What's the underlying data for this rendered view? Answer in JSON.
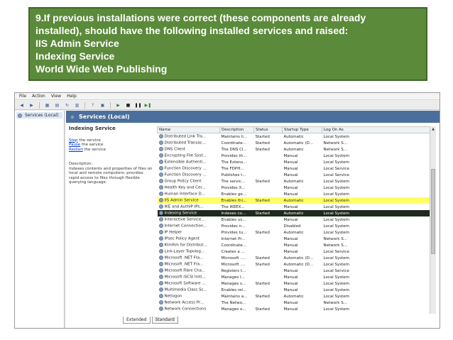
{
  "banner": {
    "lines": [
      "9.If previous installations were correct (these components are already",
      "installed), should have the following installed services and raised:",
      "IIS Admin Service",
      "Indexing Service",
      "World Wide Web Publishing"
    ],
    "background": "#5b8a3a"
  },
  "window": {
    "menu": [
      "File",
      "Action",
      "View",
      "Help"
    ],
    "tree_item": "Services (Local)",
    "main_title": "Services (Local)",
    "detail": {
      "service_name": "Indexing Service",
      "stop_link": "Stop",
      "stop_rest": " the service",
      "pause_link": "Pause",
      "pause_rest": " the service",
      "restart_link": "Restart",
      "restart_rest": " the service",
      "description_label": "Description:",
      "description_text": "Indexes contents and properties of files on local and remote computers; provides rapid access to files through flexible querying language."
    },
    "columns": [
      "Name",
      "Description",
      "Status",
      "Startup Type",
      "Log On As"
    ],
    "rows": [
      {
        "name": "Distributed Link Tra...",
        "desc": "Maintains li...",
        "status": "Started",
        "startup": "Automatic",
        "logon": "Local System",
        "state": ""
      },
      {
        "name": "Distributed Transac...",
        "desc": "Coordinate...",
        "status": "Started",
        "startup": "Automatic (D...",
        "logon": "Network S...",
        "state": ""
      },
      {
        "name": "DNS Client",
        "desc": "The DNS Cl...",
        "status": "Started",
        "startup": "Automatic",
        "logon": "Network S...",
        "state": ""
      },
      {
        "name": "Encrypting File Syst...",
        "desc": "Provides th...",
        "status": "",
        "startup": "Manual",
        "logon": "Local System",
        "state": ""
      },
      {
        "name": "Extensible Authenti...",
        "desc": "The Extens...",
        "status": "",
        "startup": "Manual",
        "logon": "Local System",
        "state": ""
      },
      {
        "name": "Function Discovery ...",
        "desc": "The FDPH...",
        "status": "",
        "startup": "Manual",
        "logon": "Local Service",
        "state": ""
      },
      {
        "name": "Function Discovery ...",
        "desc": "Publishes t...",
        "status": "",
        "startup": "Manual",
        "logon": "Local Service",
        "state": ""
      },
      {
        "name": "Group Policy Client",
        "desc": "The servic...",
        "status": "Started",
        "startup": "Automatic",
        "logon": "Local System",
        "state": ""
      },
      {
        "name": "Health Key and Cer...",
        "desc": "Provides X...",
        "status": "",
        "startup": "Manual",
        "logon": "Local System",
        "state": ""
      },
      {
        "name": "Human Interface D...",
        "desc": "Enables ge...",
        "status": "",
        "startup": "Manual",
        "logon": "Local System",
        "state": ""
      },
      {
        "name": "IIS Admin Service",
        "desc": "Enables thi...",
        "status": "Started",
        "startup": "Automatic",
        "logon": "Local System",
        "state": "hl"
      },
      {
        "name": "IKE and AuthIP IPs...",
        "desc": "The IKEEX...",
        "status": "",
        "startup": "Manual",
        "logon": "Local System",
        "state": ""
      },
      {
        "name": "Indexing Service",
        "desc": "Indexes co...",
        "status": "Started",
        "startup": "Automatic",
        "logon": "Local System",
        "state": "sel"
      },
      {
        "name": "Interactive Service...",
        "desc": "Enables us...",
        "status": "",
        "startup": "Manual",
        "logon": "Local System",
        "state": ""
      },
      {
        "name": "Internet Connection...",
        "desc": "Provides n...",
        "status": "",
        "startup": "Disabled",
        "logon": "Local System",
        "state": ""
      },
      {
        "name": "IP Helper",
        "desc": "Provides tu...",
        "status": "Started",
        "startup": "Automatic",
        "logon": "Local System",
        "state": ""
      },
      {
        "name": "IPsec Policy Agent",
        "desc": "Internet Pr...",
        "status": "",
        "startup": "Manual",
        "logon": "Network S...",
        "state": ""
      },
      {
        "name": "KtmRm for Distribut...",
        "desc": "Coordinate...",
        "status": "",
        "startup": "Manual",
        "logon": "Network S...",
        "state": ""
      },
      {
        "name": "Link-Layer Topolog...",
        "desc": "Creates a ...",
        "status": "",
        "startup": "Manual",
        "logon": "Local Service",
        "state": ""
      },
      {
        "name": "Microsoft .NET Fra...",
        "desc": "Microsoft ....",
        "status": "Started",
        "startup": "Automatic (D...",
        "logon": "Local System",
        "state": ""
      },
      {
        "name": "Microsoft .NET Fra...",
        "desc": "Microsoft ....",
        "status": "Started",
        "startup": "Automatic (D...",
        "logon": "Local System",
        "state": ""
      },
      {
        "name": "Microsoft Fibre Cha...",
        "desc": "Registers t...",
        "status": "",
        "startup": "Manual",
        "logon": "Local Service",
        "state": ""
      },
      {
        "name": "Microsoft iSCSI Initi...",
        "desc": "Manages I...",
        "status": "",
        "startup": "Manual",
        "logon": "Local System",
        "state": ""
      },
      {
        "name": "Microsoft Software ...",
        "desc": "Manages s...",
        "status": "Started",
        "startup": "Manual",
        "logon": "Local System",
        "state": ""
      },
      {
        "name": "Multimedia Class Sc...",
        "desc": "Enables rel...",
        "status": "",
        "startup": "Manual",
        "logon": "Local System",
        "state": ""
      },
      {
        "name": "Netlogon",
        "desc": "Maintains a...",
        "status": "Started",
        "startup": "Automatic",
        "logon": "Local System",
        "state": ""
      },
      {
        "name": "Network Access Pr...",
        "desc": "The Netwo...",
        "status": "",
        "startup": "Manual",
        "logon": "Network S...",
        "state": ""
      },
      {
        "name": "Network Connections",
        "desc": "Manages o...",
        "status": "Started",
        "startup": "Manual",
        "logon": "Local System",
        "state": ""
      }
    ],
    "tabs": [
      "Extended",
      "Standard"
    ],
    "colors": {
      "header_bar": "#4a6f9c",
      "highlight": "#ffff66",
      "selected": "#1e2a1e"
    }
  }
}
